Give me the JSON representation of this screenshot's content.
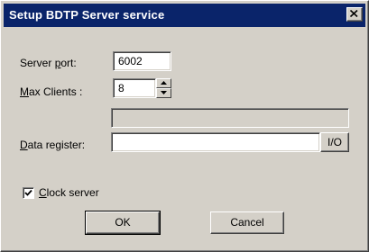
{
  "window": {
    "title": "Setup BDTP Server service",
    "close_icon": "close-icon"
  },
  "server_port": {
    "label_pre": "Server ",
    "label_accel": "p",
    "label_post": "ort:",
    "value": "6002"
  },
  "max_clients": {
    "label_accel": "M",
    "label_post": "ax Clients :",
    "value": "8"
  },
  "status_field": {
    "value": ""
  },
  "data_register": {
    "label_accel": "D",
    "label_post": "ata register:",
    "value": "",
    "io_button": "I/O"
  },
  "clock_server": {
    "label_accel": "C",
    "label_post": "lock server",
    "checked": true
  },
  "buttons": {
    "ok": "OK",
    "cancel": "Cancel"
  }
}
